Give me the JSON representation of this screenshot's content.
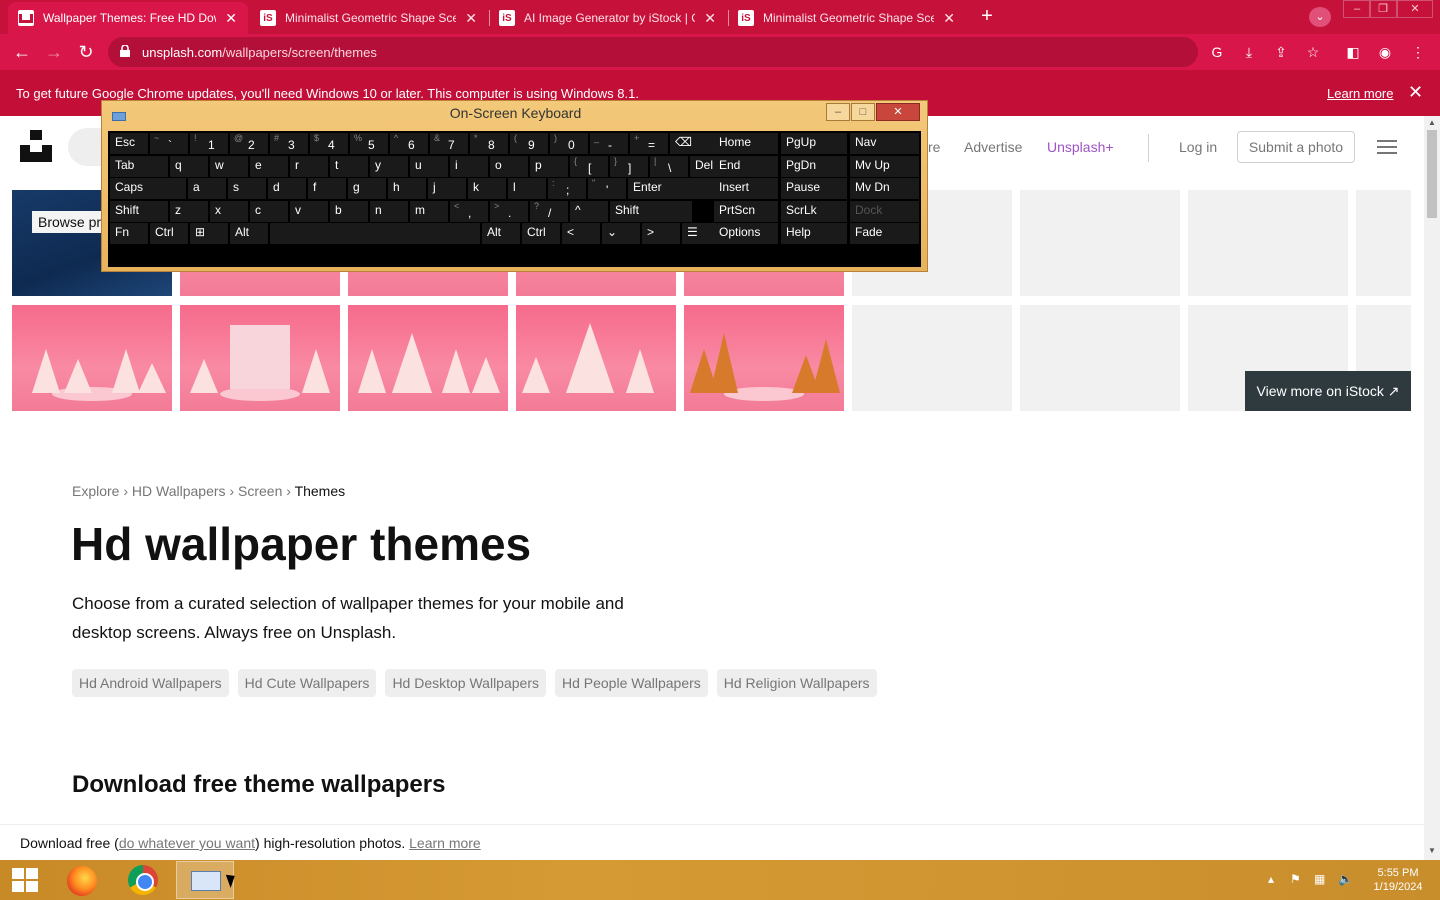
{
  "browser": {
    "tabs": [
      {
        "title": "Wallpaper Themes: Free HD Dow",
        "favicon": "unsplash-favicon",
        "active": true
      },
      {
        "title": "Minimalist Geometric Shape Sce",
        "favicon": "istock-favicon",
        "active": false
      },
      {
        "title": "AI Image Generator by iStock | C",
        "favicon": "istock-favicon",
        "active": false
      },
      {
        "title": "Minimalist Geometric Shape Sce",
        "favicon": "istock-favicon",
        "active": false
      }
    ],
    "url_host": "unsplash.com",
    "url_path": "/wallpapers/screen/themes",
    "infobar_message": "To get future Google Chrome updates, you'll need Windows 10 or later. This computer is using Windows 8.1.",
    "infobar_learn_more": "Learn more",
    "accent_color": "#d8164a"
  },
  "unsplash_nav": {
    "partial_item": "re",
    "advertise": "Advertise",
    "unsplash_plus": "Unsplash+",
    "login": "Log in",
    "submit": "Submit a photo"
  },
  "istock": {
    "browse_label": "Browse pre",
    "view_more": "View more on iStock ↗"
  },
  "page": {
    "breadcrumb": [
      "Explore",
      "HD Wallpapers",
      "Screen",
      "Themes"
    ],
    "breadcrumb_sep": "›",
    "title": "Hd wallpaper themes",
    "description": "Choose from a curated selection of wallpaper themes for your mobile and desktop screens. Always free on Unsplash.",
    "chips": [
      "Hd Android Wallpapers",
      "Hd Cute Wallpapers",
      "Hd Desktop Wallpapers",
      "Hd People Wallpapers",
      "Hd Religion Wallpapers"
    ],
    "section_title": "Download free theme wallpapers",
    "footer_prefix": "Download free (",
    "footer_link": "do whatever you want",
    "footer_middle": ") high-resolution photos.",
    "footer_learn": "Learn more"
  },
  "osk": {
    "title": "On-Screen Keyboard",
    "rows": [
      [
        {
          "m": "Esc"
        },
        {
          "s": "~",
          "m": "`"
        },
        {
          "s": "!",
          "m": "1"
        },
        {
          "s": "@",
          "m": "2"
        },
        {
          "s": "#",
          "m": "3"
        },
        {
          "s": "$",
          "m": "4"
        },
        {
          "s": "%",
          "m": "5"
        },
        {
          "s": "^",
          "m": "6"
        },
        {
          "s": "&",
          "m": "7"
        },
        {
          "s": "*",
          "m": "8"
        },
        {
          "s": "(",
          "m": "9"
        },
        {
          "s": ")",
          "m": "0"
        },
        {
          "s": "_",
          "m": "-"
        },
        {
          "s": "+",
          "m": "="
        },
        {
          "m": "⌫"
        }
      ],
      [
        {
          "m": "Tab"
        },
        {
          "m": "q"
        },
        {
          "m": "w"
        },
        {
          "m": "e"
        },
        {
          "m": "r"
        },
        {
          "m": "t"
        },
        {
          "m": "y"
        },
        {
          "m": "u"
        },
        {
          "m": "i"
        },
        {
          "m": "o"
        },
        {
          "m": "p"
        },
        {
          "s": "{",
          "m": "["
        },
        {
          "s": "}",
          "m": "]"
        },
        {
          "s": "|",
          "m": "\\"
        },
        {
          "m": "Del"
        }
      ],
      [
        {
          "m": "Caps"
        },
        {
          "m": "a"
        },
        {
          "m": "s"
        },
        {
          "m": "d"
        },
        {
          "m": "f"
        },
        {
          "m": "g"
        },
        {
          "m": "h"
        },
        {
          "m": "j"
        },
        {
          "m": "k"
        },
        {
          "m": "l"
        },
        {
          "s": ":",
          "m": ";"
        },
        {
          "s": "\"",
          "m": "'"
        },
        {
          "m": "Enter"
        }
      ],
      [
        {
          "m": "Shift"
        },
        {
          "m": "z"
        },
        {
          "m": "x"
        },
        {
          "m": "c"
        },
        {
          "m": "v"
        },
        {
          "m": "b"
        },
        {
          "m": "n"
        },
        {
          "m": "m"
        },
        {
          "s": "<",
          "m": ","
        },
        {
          "s": ">",
          "m": "."
        },
        {
          "s": "?",
          "m": "/"
        },
        {
          "m": "^"
        },
        {
          "m": "Shift"
        }
      ],
      [
        {
          "m": "Fn"
        },
        {
          "m": "Ctrl"
        },
        {
          "m": "⊞"
        },
        {
          "m": "Alt"
        },
        {
          "m": ""
        },
        {
          "m": "Alt"
        },
        {
          "m": "Ctrl"
        },
        {
          "m": "<"
        },
        {
          "m": "⌄"
        },
        {
          "m": ">"
        },
        {
          "m": "☰"
        }
      ]
    ],
    "side_keys": [
      [
        "Home",
        "PgUp",
        "Nav"
      ],
      [
        "End",
        "PgDn",
        "Mv Up"
      ],
      [
        "Insert",
        "Pause",
        "Mv Dn"
      ],
      [
        "PrtScn",
        "ScrLk",
        "Dock"
      ],
      [
        "Options",
        "Help",
        "Fade"
      ]
    ]
  },
  "taskbar": {
    "time": "5:55 PM",
    "date": "1/19/2024",
    "accent_color": "#d69a34"
  }
}
